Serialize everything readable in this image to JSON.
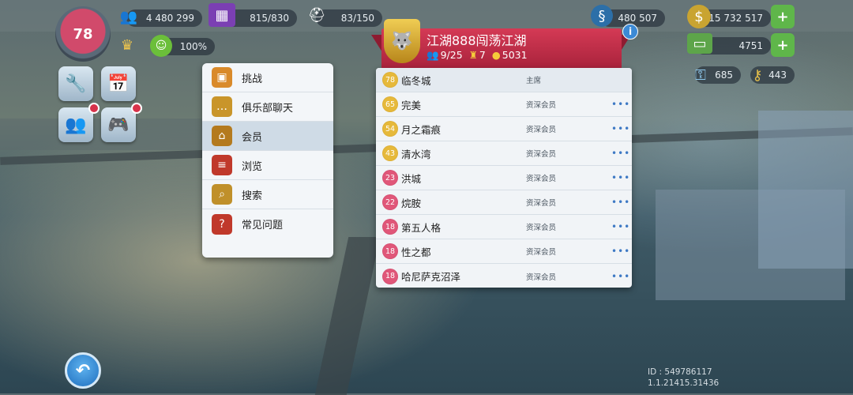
{
  "hud": {
    "level": "78",
    "population": "4 480 299",
    "storage": "815/830",
    "workers": "83/150",
    "happiness": "100%",
    "simoleons": "480 507",
    "coins": "15 732 517",
    "bucks": "4751",
    "keys_a": "685",
    "keys_b": "443"
  },
  "menu": {
    "items": [
      {
        "label": "挑战",
        "icon": "chest-icon"
      },
      {
        "label": "俱乐部聊天",
        "icon": "chat-bubble-icon"
      },
      {
        "label": "会员",
        "icon": "temple-icon"
      },
      {
        "label": "浏览",
        "icon": "list-shield-icon"
      },
      {
        "label": "搜索",
        "icon": "magnifier-icon"
      },
      {
        "label": "常见问题",
        "icon": "book-icon"
      }
    ]
  },
  "club": {
    "name": "江湖888闯荡江湖",
    "members": "9/25",
    "trophies": "7",
    "points": "5031"
  },
  "members": [
    {
      "level": "78",
      "name": "临冬城",
      "role": "主席",
      "color": "gold"
    },
    {
      "level": "65",
      "name": "完美",
      "role": "资深会员",
      "color": "gold"
    },
    {
      "level": "54",
      "name": "月之霜痕",
      "role": "资深会员",
      "color": "gold"
    },
    {
      "level": "43",
      "name": "清水湾",
      "role": "资深会员",
      "color": "gold"
    },
    {
      "level": "23",
      "name": "洪城",
      "role": "资深会员",
      "color": "pink"
    },
    {
      "level": "22",
      "name": "烷胺",
      "role": "资深会员",
      "color": "pink"
    },
    {
      "level": "18",
      "name": "第五人格",
      "role": "资深会员",
      "color": "pink"
    },
    {
      "level": "18",
      "name": "性之都",
      "role": "资深会员",
      "color": "pink"
    },
    {
      "level": "18",
      "name": "哈尼萨克沼泽",
      "role": "资深会员",
      "color": "pink"
    }
  ],
  "more_label": "•••",
  "footer": {
    "id": "ID : 549786117",
    "version": "1.1.21415.31436"
  },
  "colors": {
    "banner": "#c22d48",
    "accent_blue": "#3e79c4",
    "gold": "#e6b93b",
    "pink": "#e05779"
  }
}
